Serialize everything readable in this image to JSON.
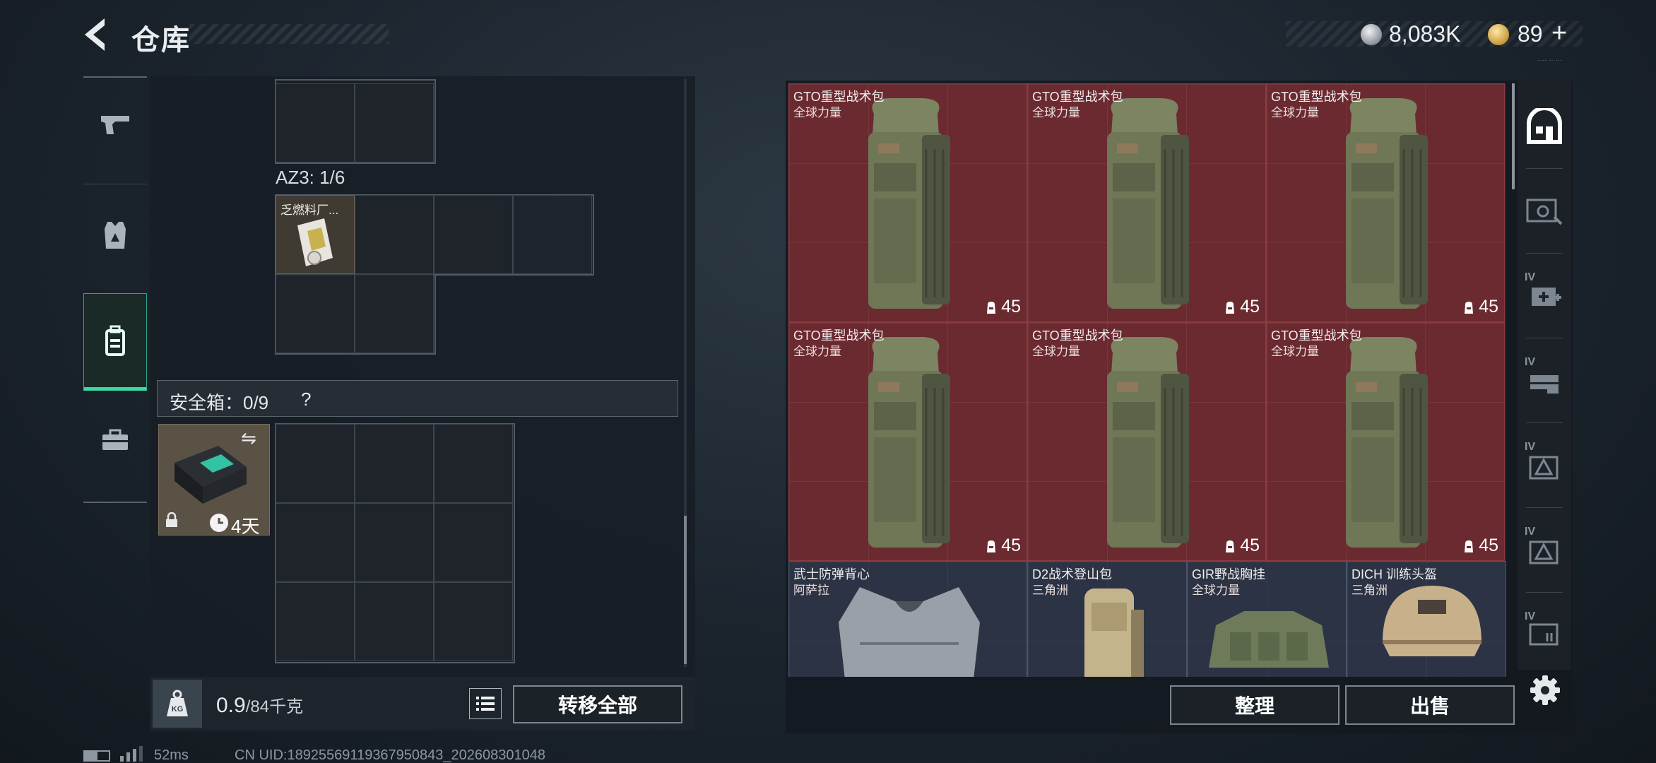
{
  "header": {
    "title": "仓库",
    "currency": {
      "silver_amount": "8,083K",
      "gold_amount": "89",
      "plus_label": "+",
      "silver_icon": "silver-coin-icon",
      "gold_icon": "gold-coin-icon"
    },
    "corner_tag": "···· ·· ···"
  },
  "left_rail": {
    "items": [
      {
        "name": "weapon",
        "icon": "pistol-icon"
      },
      {
        "name": "armor",
        "icon": "armor-vest-icon"
      },
      {
        "name": "backpack",
        "icon": "backpack-icon",
        "active": true
      },
      {
        "name": "toolbox",
        "icon": "briefcase-icon"
      }
    ]
  },
  "inventory": {
    "az3_label": "AZ3: 1/6",
    "fuel_item": {
      "name": "乏燃料厂...",
      "icon": "fuel-pass-icon"
    },
    "safebox_label": "安全箱：0/9",
    "safebox_help": "?",
    "safecase": {
      "duration": "4天",
      "icon": "safe-case-icon",
      "swap_icon": "swap-icon",
      "lock_icon": "lock-icon",
      "clock_icon": "clock-icon"
    },
    "weight_current": "0.9",
    "weight_max": "/84千克",
    "weight_icon": "kg-weight-icon",
    "list_icon": "list-icon",
    "transfer_all_label": "转移全部"
  },
  "stash": {
    "cards": [
      {
        "name": "GTO重型战术包",
        "source": "全球力量",
        "durability": "45",
        "kind": "backpack",
        "tone": "red"
      },
      {
        "name": "GTO重型战术包",
        "source": "全球力量",
        "durability": "45",
        "kind": "backpack",
        "tone": "red"
      },
      {
        "name": "GTO重型战术包",
        "source": "全球力量",
        "durability": "45",
        "kind": "backpack",
        "tone": "red"
      },
      {
        "name": "GTO重型战术包",
        "source": "全球力量",
        "durability": "45",
        "kind": "backpack",
        "tone": "red"
      },
      {
        "name": "GTO重型战术包",
        "source": "全球力量",
        "durability": "45",
        "kind": "backpack",
        "tone": "red"
      },
      {
        "name": "GTO重型战术包",
        "source": "全球力量",
        "durability": "45",
        "kind": "backpack",
        "tone": "red"
      },
      {
        "name": "武士防弹背心",
        "source": "阿萨拉",
        "kind": "vest",
        "tone": "blue"
      },
      {
        "name": "D2战术登山包",
        "source": "三角洲",
        "kind": "hiking-pack",
        "tone": "blue"
      },
      {
        "name": "GIR野战胸挂",
        "source": "全球力量",
        "kind": "chest-rig",
        "tone": "blue"
      },
      {
        "name": "DICH 训练头盔",
        "source": "三角洲",
        "kind": "helmet",
        "tone": "blue"
      }
    ],
    "sort_label": "整理",
    "sell_label": "出售"
  },
  "right_rail": {
    "items": [
      {
        "name": "stash-home",
        "icon": "stash-home-icon",
        "active": true,
        "tier": ""
      },
      {
        "name": "case-1",
        "icon": "case-icon",
        "tier": ""
      },
      {
        "name": "medical",
        "icon": "medkit-icon",
        "tier": "IV"
      },
      {
        "name": "ammo",
        "icon": "ammo-box-icon",
        "tier": "IV"
      },
      {
        "name": "tier-a",
        "icon": "warning-crate-icon",
        "tier": "IV"
      },
      {
        "name": "tier-b",
        "icon": "warning-crate-icon",
        "tier": "IV"
      },
      {
        "name": "tier-c",
        "icon": "storage-icon",
        "tier": "IV"
      }
    ],
    "settings_icon": "gear-icon"
  },
  "status_bar": {
    "ping": "52ms",
    "uid": "CN UID:18925569119367950843_202608301048",
    "battery_icon": "battery-icon",
    "signal_icon": "signal-icon"
  },
  "colors": {
    "accent_green": "#3ed8a4",
    "stash_red": "#6b2a30",
    "stash_blue": "#2b3344"
  }
}
